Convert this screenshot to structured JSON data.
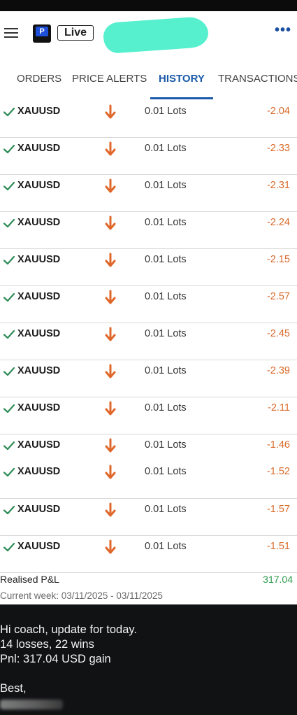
{
  "header": {
    "menu_icon": "hamburger-icon",
    "logo_letter": "P",
    "mode_label": "Live",
    "more_icon": "more-dots-icon"
  },
  "tabs": [
    {
      "label": "ORDERS",
      "active": false
    },
    {
      "label": "PRICE ALERTS",
      "active": false
    },
    {
      "label": "HISTORY",
      "active": true
    },
    {
      "label": "TRANSACTIONS",
      "active": false
    }
  ],
  "trades": [
    {
      "symbol": "XAUUSD",
      "lots": "0.01 Lots",
      "pnl": "-2.04"
    },
    {
      "symbol": "XAUUSD",
      "lots": "0.01 Lots",
      "pnl": "-2.33"
    },
    {
      "symbol": "XAUUSD",
      "lots": "0.01 Lots",
      "pnl": "-2.31"
    },
    {
      "symbol": "XAUUSD",
      "lots": "0.01 Lots",
      "pnl": "-2.24"
    },
    {
      "symbol": "XAUUSD",
      "lots": "0.01 Lots",
      "pnl": "-2.15"
    },
    {
      "symbol": "XAUUSD",
      "lots": "0.01 Lots",
      "pnl": "-2.57"
    },
    {
      "symbol": "XAUUSD",
      "lots": "0.01 Lots",
      "pnl": "-2.45"
    },
    {
      "symbol": "XAUUSD",
      "lots": "0.01 Lots",
      "pnl": "-2.39"
    },
    {
      "symbol": "XAUUSD",
      "lots": "0.01 Lots",
      "pnl": "-2.11"
    },
    {
      "symbol": "XAUUSD",
      "lots": "0.01 Lots",
      "pnl": "-1.46"
    },
    {
      "symbol": "XAUUSD",
      "lots": "0.01 Lots",
      "pnl": "-1.52"
    },
    {
      "symbol": "XAUUSD",
      "lots": "0.01 Lots",
      "pnl": "-1.57"
    },
    {
      "symbol": "XAUUSD",
      "lots": "0.01 Lots",
      "pnl": "-1.51"
    }
  ],
  "summary": {
    "realised_label": "Realised P&L",
    "realised_value": "317.04",
    "week_label": "Current week: 03/11/2025 - 03/11/2025"
  },
  "message": {
    "line1": "Hi coach, update for today.",
    "line2": "14 losses, 22 wins",
    "line3": "Pnl: 317.04 USD gain",
    "line4": "Best,"
  },
  "colors": {
    "accent": "#1a5aa8",
    "loss": "#d96a2a",
    "gain": "#2a9a4a",
    "check": "#2e8b57",
    "redaction": "#56f0cf"
  }
}
